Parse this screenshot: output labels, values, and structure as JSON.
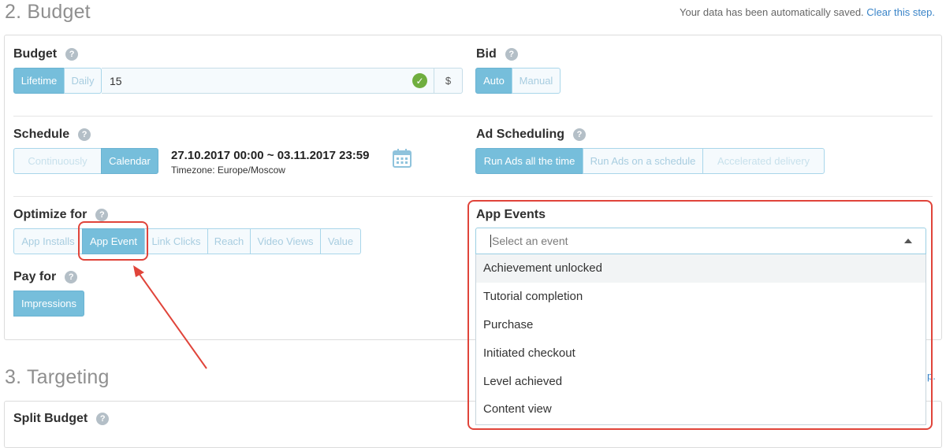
{
  "budget_step": {
    "title": "2. Budget",
    "autosave_text": "Your data has been automatically saved.",
    "autosave_link": "Clear this step."
  },
  "budget": {
    "label": "Budget",
    "modes": [
      "Lifetime",
      "Daily"
    ],
    "active_mode": "Lifetime",
    "value": "15",
    "currency": "$"
  },
  "bid": {
    "label": "Bid",
    "modes": [
      "Auto",
      "Manual"
    ],
    "active_mode": "Auto"
  },
  "schedule": {
    "label": "Schedule",
    "modes": [
      "Continuously",
      "Calendar"
    ],
    "active_mode": "Calendar",
    "date_range": "27.10.2017 00:00 ~ 03.11.2017 23:59",
    "timezone": "Timezone: Europe/Moscow"
  },
  "ad_scheduling": {
    "label": "Ad Scheduling",
    "modes": [
      "Run Ads all the time",
      "Run Ads on a schedule",
      "Accelerated delivery"
    ],
    "active_mode": "Run Ads all the time"
  },
  "optimize_for": {
    "label": "Optimize for",
    "modes": [
      "App Installs",
      "App Event",
      "Link Clicks",
      "Reach",
      "Video Views",
      "Value"
    ],
    "active_mode": "App Event"
  },
  "pay_for": {
    "label": "Pay for",
    "modes": [
      "Impressions"
    ],
    "active_mode": "Impressions"
  },
  "app_events": {
    "label": "App Events",
    "placeholder": "Select an event",
    "options": [
      "Achievement unlocked",
      "Tutorial completion",
      "Purchase",
      "Initiated checkout",
      "Level achieved",
      "Content view"
    ],
    "highlighted_option": "Achievement unlocked"
  },
  "targeting_step": {
    "title": "3. Targeting",
    "link_fragment": "p."
  },
  "split_budget": {
    "label": "Split Budget"
  },
  "help_glyph": "?",
  "colors": {
    "accent": "#76bedb",
    "annotation_red": "#e0443a",
    "link": "#3a84c8",
    "success": "#6fae3f"
  },
  "icons": [
    "help-icon",
    "checkmark-icon",
    "calendar-icon",
    "caret-up-icon"
  ]
}
